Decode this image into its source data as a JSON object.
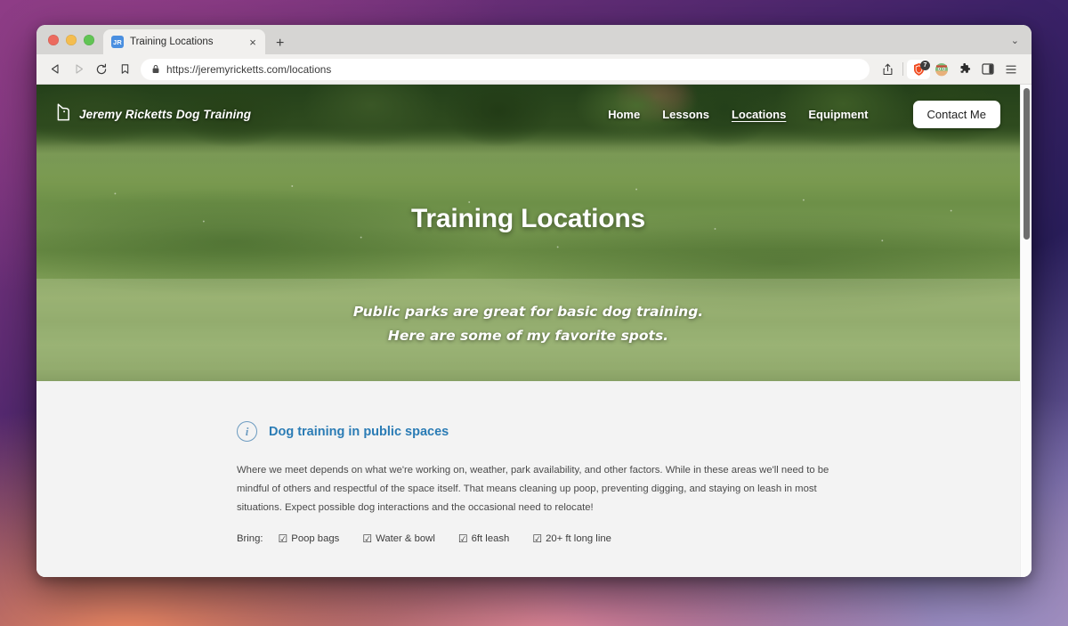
{
  "browser": {
    "traffic_lights": [
      "close",
      "minimize",
      "maximize"
    ],
    "tab": {
      "favicon_text": "JR",
      "title": "Training Locations",
      "close_glyph": "×"
    },
    "new_tab_glyph": "+",
    "window_chevron_glyph": "⌄",
    "nav": {
      "back_glyph": "◁",
      "forward_glyph": "▷",
      "reload_glyph": "↻",
      "bookmark_glyph": "☐"
    },
    "omnibox": {
      "lock_icon": "lock-icon",
      "url": "https://jeremyricketts.com/locations"
    },
    "toolbar_icons": {
      "share": "share-icon",
      "shield": "brave-shield-icon",
      "shield_badge_count": "7",
      "profile": "profile-avatar-icon",
      "extensions": "puzzle-piece-icon",
      "sidebar": "sidebar-panel-icon",
      "menu": "hamburger-menu-icon"
    }
  },
  "site": {
    "brand": {
      "logo": "dog-head-icon",
      "name": "Jeremy Ricketts Dog Training"
    },
    "nav_links": [
      {
        "label": "Home",
        "active": false
      },
      {
        "label": "Lessons",
        "active": false
      },
      {
        "label": "Locations",
        "active": true
      },
      {
        "label": "Equipment",
        "active": false
      }
    ],
    "contact_button": "Contact Me",
    "hero": {
      "title": "Training Locations",
      "tagline_line1": "Public parks are great for basic dog training.",
      "tagline_line2": "Here are some of my favorite spots."
    },
    "info": {
      "icon": "info-circle-icon",
      "icon_glyph": "i",
      "title": "Dog training in public spaces",
      "body": "Where we meet depends on what we're working on, weather, park availability, and other factors. While in these areas we'll need to be mindful of others and respectful of the space itself. That means cleaning up poop, preventing digging, and staying on leash in most situations. Expect possible dog interactions and the occasional need to relocate!",
      "bring_label": "Bring:",
      "bring_items": [
        {
          "checkbox": "☑",
          "label": "Poop bags"
        },
        {
          "checkbox": "☑",
          "label": "Water & bowl"
        },
        {
          "checkbox": "☑",
          "label": "6ft leash"
        },
        {
          "checkbox": "☑",
          "label": "20+ ft long line"
        }
      ]
    },
    "colors": {
      "heading_blue": "#2b7cb5",
      "info_icon_blue": "#6c9bc0",
      "content_bg": "#f3f3f3"
    }
  }
}
